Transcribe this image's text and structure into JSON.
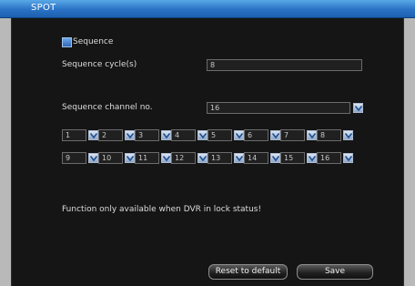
{
  "window": {
    "title": "SPOT"
  },
  "sequence": {
    "enabled_label": "Sequence",
    "cycle_label": "Sequence cycle(s)",
    "cycle_value": "8",
    "channel_label": "Sequence channel no.",
    "channel_value": "16"
  },
  "channels": [
    "1",
    "2",
    "3",
    "4",
    "5",
    "6",
    "7",
    "8",
    "9",
    "10",
    "11",
    "12",
    "13",
    "14",
    "15",
    "16"
  ],
  "notice": "Function only available when DVR in lock status!",
  "buttons": {
    "reset_label": "Reset to default",
    "save_label": "Save"
  },
  "colors": {
    "title_bar": "#2a72c4",
    "panel": "#151515",
    "accent": "#4f8fd8"
  },
  "icons": {
    "dropdown": "chevron-down-icon"
  }
}
